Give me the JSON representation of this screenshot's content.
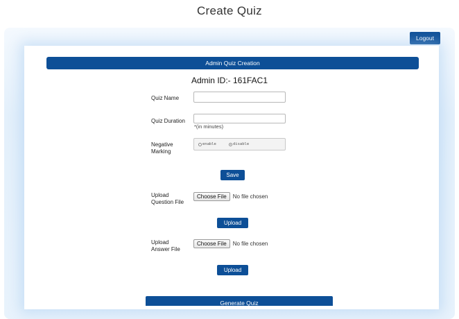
{
  "page_title": "Create Quiz",
  "logout_label": "Logout",
  "banner": "Admin Quiz Creation",
  "admin_id": "Admin ID:- 161FAC1",
  "form": {
    "quiz_name_label": "Quiz Name",
    "quiz_name_value": "",
    "quiz_duration_label": "Quiz Duration",
    "quiz_duration_value": "",
    "duration_hint": "*(in minutes)",
    "negative_marking_label_1": "Negative",
    "negative_marking_label_2": "Marking",
    "negative_options": [
      {
        "label": "enable",
        "checked": false
      },
      {
        "label": "disable",
        "checked": true
      }
    ],
    "save_label": "Save"
  },
  "question_upload": {
    "label_1": "Upload",
    "label_2": "Question File",
    "choose_label": "Choose File",
    "status": "No file chosen",
    "upload_label": "Upload"
  },
  "answer_upload": {
    "label_1": "Upload",
    "label_2": "Answer File",
    "choose_label": "Choose File",
    "status": "No file chosen",
    "upload_label": "Upload"
  },
  "generate_label": "Generate Quiz",
  "colors": {
    "primary": "#0d4f97",
    "background_glow": "#e4f0fb"
  }
}
